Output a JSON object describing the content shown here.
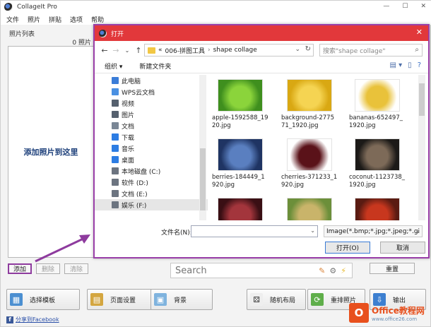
{
  "app": {
    "title": "CollageIt Pro",
    "menu": [
      "文件",
      "照片",
      "拼贴",
      "选项",
      "帮助"
    ]
  },
  "photo_panel": {
    "header": "照片列表",
    "count": "0 照片",
    "drop_hint": "添加照片到这里",
    "buttons": {
      "add": "添加",
      "delete": "删除",
      "clear": "清除"
    }
  },
  "search": {
    "placeholder": "Search"
  },
  "reset_label": "重置",
  "toolbar": {
    "template": "选择模板",
    "page_setup": "页面设置",
    "background": "背景",
    "random_layout": "随机布局",
    "shuffle": "重排照片",
    "export": "输出"
  },
  "facebook_link": "分享到Facebook",
  "dialog": {
    "title": "打开",
    "address": {
      "prefix": "«",
      "parts": [
        "006-拼图工具",
        "shape collage"
      ]
    },
    "search_placeholder": "搜索\"shape collage\"",
    "organize": "组织 ▾",
    "new_folder": "新建文件夹",
    "tree": [
      {
        "label": "此电脑",
        "icon": "computer-icon",
        "color": "#3b7dd8"
      },
      {
        "label": "WPS云文档",
        "icon": "cloud-icon",
        "color": "#4a90e2"
      },
      {
        "label": "视频",
        "icon": "video-icon",
        "color": "#55606e"
      },
      {
        "label": "图片",
        "icon": "picture-icon",
        "color": "#55606e"
      },
      {
        "label": "文档",
        "icon": "document-icon",
        "color": "#7a8796"
      },
      {
        "label": "下载",
        "icon": "download-icon",
        "color": "#2d7de3"
      },
      {
        "label": "音乐",
        "icon": "music-icon",
        "color": "#2d7de3"
      },
      {
        "label": "桌面",
        "icon": "desktop-icon",
        "color": "#2d7de3"
      },
      {
        "label": "本地磁盘 (C:)",
        "icon": "drive-icon",
        "color": "#6c7480"
      },
      {
        "label": "软件 (D:)",
        "icon": "drive-icon",
        "color": "#6c7480"
      },
      {
        "label": "文档 (E:)",
        "icon": "drive-icon",
        "color": "#6c7480"
      },
      {
        "label": "娱乐 (F:)",
        "icon": "drive-icon",
        "color": "#6c7480"
      }
    ],
    "files": [
      {
        "name": "apple-1592588_1920.jpg",
        "colors": [
          "#3f8f1e",
          "#8bd43b"
        ]
      },
      {
        "name": "background-277571_1920.jpg",
        "colors": [
          "#d9a813",
          "#f5d452"
        ]
      },
      {
        "name": "bananas-652497_1920.jpg",
        "colors": [
          "#ffffff",
          "#e9c23a"
        ]
      },
      {
        "name": "berries-184449_1920.jpg",
        "colors": [
          "#1f3463",
          "#5a7fc0"
        ]
      },
      {
        "name": "cherries-371233_1920.jpg",
        "colors": [
          "#ffffff",
          "#5a1219"
        ]
      },
      {
        "name": "coconut-1123738_1920.jpg",
        "colors": [
          "#1c1a18",
          "#7d6a58"
        ]
      },
      {
        "name": "",
        "colors": [
          "#3a0f14",
          "#a3353c"
        ]
      },
      {
        "name": "",
        "colors": [
          "#6c8f3a",
          "#c9b46a"
        ]
      },
      {
        "name": "",
        "colors": [
          "#5a1b12",
          "#c8371e"
        ]
      }
    ],
    "filename_label": "文件名(N):",
    "filename_value": "",
    "filter": "Image(*.bmp;*.jpg;*.jpeg;*.gi",
    "open_button": "打开(O)",
    "cancel_button": "取消"
  },
  "watermark": {
    "main": "Office教程网",
    "sub": "www.office26.com"
  }
}
